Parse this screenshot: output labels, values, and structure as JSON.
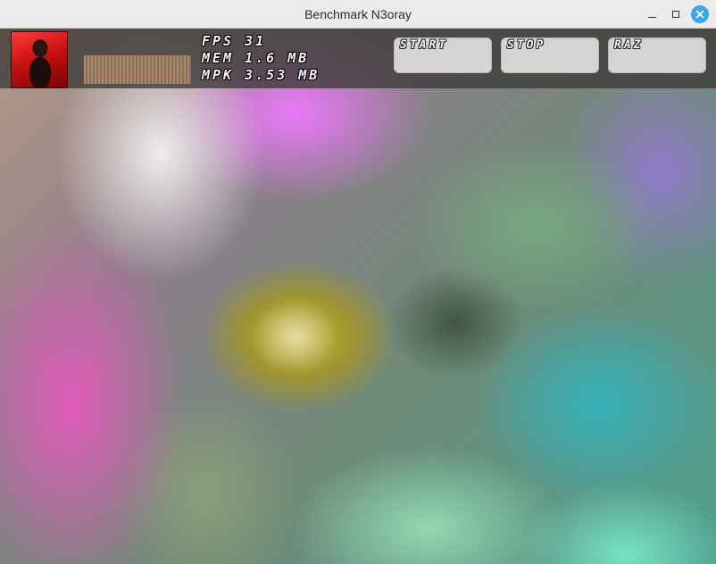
{
  "window": {
    "title": "Benchmark N3oray"
  },
  "hud": {
    "stats": {
      "fps": "FPS 31",
      "mem": "MEM 1.6 MB",
      "mpk": "MPK 3.53 MB"
    },
    "buttons": {
      "start": "START",
      "stop": "STOP",
      "raz": "RAZ"
    }
  },
  "icons": {
    "minimize": "minimize-icon",
    "maximize": "maximize-icon",
    "close": "close-icon"
  },
  "colors": {
    "close_button": "#3aa6e8",
    "hud_background": "#3c3a37",
    "button_face": "#d4d4d4"
  }
}
